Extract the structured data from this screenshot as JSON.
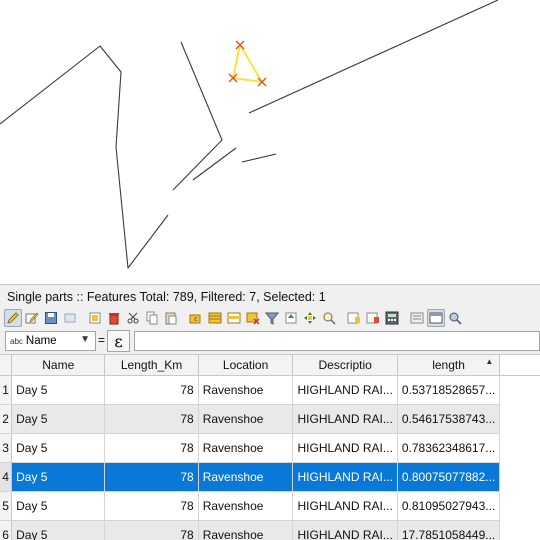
{
  "title_bar": {
    "text": "Single parts :: Features Total: 789, Filtered: 7, Selected: 1"
  },
  "toolbar": {
    "icons": [
      "toggle-editing-icon",
      "multi-edit-icon",
      "save-edits-icon",
      "reload-icon",
      "add-feature-icon",
      "delete-feature-icon",
      "cut-icon",
      "copy-icon",
      "paste-icon",
      "expression-select-icon",
      "select-all-icon",
      "invert-selection-icon",
      "deselect-all-icon",
      "filter-selected-icon",
      "move-selection-to-top-icon",
      "pan-to-selected-icon",
      "zoom-to-selected-icon",
      "new-field-icon",
      "delete-field-icon",
      "field-calculator-icon",
      "conditional-formatting-icon",
      "dock-icon",
      "actions-icon"
    ]
  },
  "filter_bar": {
    "field_type": "abc",
    "field_name": "Name",
    "equals": "=",
    "expression_symbol": "ε",
    "value": ""
  },
  "table": {
    "columns": [
      "Name",
      "Length_Km",
      "Location",
      "Descriptio",
      "length"
    ],
    "rows": [
      {
        "num": "1",
        "name": "Day 5",
        "length_km": "78",
        "location": "Ravenshoe",
        "descriptio": "HIGHLAND RAI...",
        "length": "0.53718528657..."
      },
      {
        "num": "2",
        "name": "Day 5",
        "length_km": "78",
        "location": "Ravenshoe",
        "descriptio": "HIGHLAND RAI...",
        "length": "0.54617538743..."
      },
      {
        "num": "3",
        "name": "Day 5",
        "length_km": "78",
        "location": "Ravenshoe",
        "descriptio": "HIGHLAND RAI...",
        "length": "0.78362348617..."
      },
      {
        "num": "4",
        "name": "Day 5",
        "length_km": "78",
        "location": "Ravenshoe",
        "descriptio": "HIGHLAND RAI...",
        "length": "0.80075077882..."
      },
      {
        "num": "5",
        "name": "Day 5",
        "length_km": "78",
        "location": "Ravenshoe",
        "descriptio": "HIGHLAND RAI...",
        "length": "0.81095027943..."
      },
      {
        "num": "6",
        "name": "Day 5",
        "length_km": "78",
        "location": "Ravenshoe",
        "descriptio": "HIGHLAND RAI...",
        "length": "17.7851058449..."
      }
    ],
    "selected_row": 4,
    "sorted_column": "length"
  },
  "colors": {
    "selection": "#0a78d7",
    "highlight_feature": "#f5e342",
    "vertex_marker": "#d9531e",
    "line": "#333333"
  }
}
